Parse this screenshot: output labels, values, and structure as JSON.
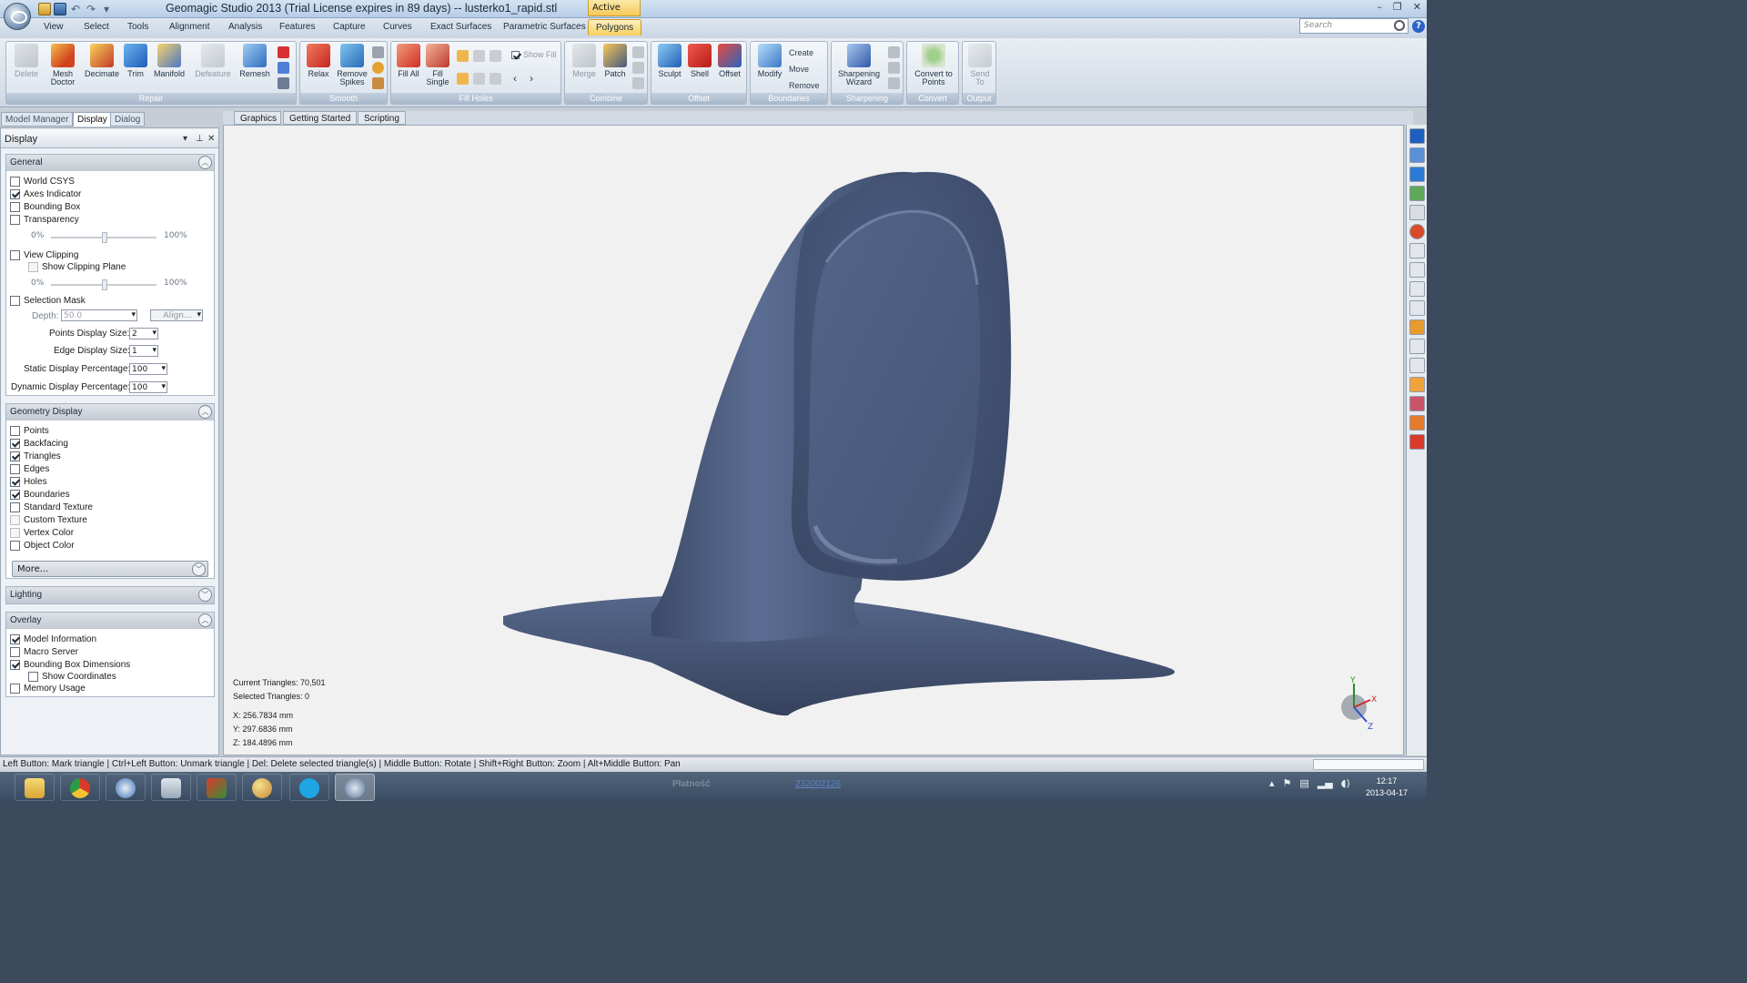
{
  "window": {
    "title": "Geomagic Studio 2013 (Trial License expires in 89 days) -- lusterko1_rapid.stl",
    "active_badge": "Active"
  },
  "menu": {
    "tabs": [
      "View",
      "Select",
      "Tools",
      "Alignment",
      "Analysis",
      "Features",
      "Capture",
      "Curves",
      "Exact Surfaces",
      "Parametric Surfaces",
      "Polygons"
    ],
    "selected": "Polygons"
  },
  "search": {
    "placeholder": "Search"
  },
  "ribbon": {
    "groups": {
      "repair": {
        "label": "Repair",
        "buttons": [
          "Delete",
          "Mesh Doctor",
          "Decimate",
          "Trim",
          "Manifold",
          "Defeature",
          "Remesh"
        ]
      },
      "smooth": {
        "label": "Smooth",
        "buttons": [
          "Relax",
          "Remove Spikes"
        ]
      },
      "fill_holes": {
        "label": "Fill Holes",
        "buttons": [
          "Fill All",
          "Fill Single"
        ],
        "show_fill": "Show Fill"
      },
      "combine": {
        "label": "Combine",
        "buttons": [
          "Merge",
          "Patch"
        ]
      },
      "offset": {
        "label": "Offset",
        "buttons": [
          "Sculpt",
          "Shell",
          "Offset"
        ]
      },
      "boundaries": {
        "label": "Boundaries",
        "buttons": [
          "Modify"
        ],
        "small": [
          "Create",
          "Move",
          "Remove"
        ]
      },
      "sharpening": {
        "label": "Sharpening",
        "buttons": [
          "Sharpening Wizard"
        ]
      },
      "convert": {
        "label": "Convert",
        "buttons": [
          "Convert to Points"
        ]
      },
      "output": {
        "label": "Output",
        "buttons": [
          "Send To"
        ]
      }
    }
  },
  "panel": {
    "tabs": [
      "Model Manager",
      "Display",
      "Dialog"
    ],
    "selected_tab": "Display",
    "title": "Display",
    "general": {
      "title": "General",
      "items": [
        {
          "label": "World CSYS",
          "checked": false
        },
        {
          "label": "Axes Indicator",
          "checked": true
        },
        {
          "label": "Bounding Box",
          "checked": false
        },
        {
          "label": "Transparency",
          "checked": false
        }
      ],
      "slider_min": "0%",
      "slider_max": "100%",
      "view_clipping": "View Clipping",
      "show_clipping_plane": "Show Clipping Plane",
      "selection_mask": "Selection Mask",
      "depth_label": "Depth:",
      "depth_value": "50.0",
      "align_button": "Align...",
      "points_size_label": "Points Display Size:",
      "points_size_value": "2",
      "edge_size_label": "Edge Display Size:",
      "edge_size_value": "1",
      "static_pct_label": "Static Display Percentage:",
      "static_pct_value": "100",
      "dynamic_pct_label": "Dynamic Display Percentage:",
      "dynamic_pct_value": "100"
    },
    "geometry": {
      "title": "Geometry Display",
      "items": [
        {
          "label": "Points",
          "checked": false
        },
        {
          "label": "Backfacing",
          "checked": true
        },
        {
          "label": "Triangles",
          "checked": true
        },
        {
          "label": "Edges",
          "checked": false
        },
        {
          "label": "Holes",
          "checked": true
        },
        {
          "label": "Boundaries",
          "checked": true
        },
        {
          "label": "Standard Texture",
          "checked": false
        },
        {
          "label": "Custom Texture",
          "checked": false
        },
        {
          "label": "Vertex Color",
          "checked": false
        },
        {
          "label": "Object Color",
          "checked": false
        }
      ],
      "more_button": "More..."
    },
    "lighting": {
      "title": "Lighting"
    },
    "overlay": {
      "title": "Overlay",
      "items": [
        {
          "label": "Model Information",
          "checked": true
        },
        {
          "label": "Macro Server",
          "checked": false
        },
        {
          "label": "Bounding Box Dimensions",
          "checked": true
        },
        {
          "label": "Show Coordinates",
          "checked": false
        },
        {
          "label": "Memory Usage",
          "checked": false
        }
      ]
    }
  },
  "viewport": {
    "tabs": [
      "Graphics",
      "Getting Started",
      "Scripting"
    ],
    "selected_tab": "Graphics",
    "info": {
      "current_triangles": "Current Triangles: 70,501",
      "selected_triangles": "Selected Triangles: 0",
      "x": "X:  256.7834 mm",
      "y": "Y:  297.6836 mm",
      "z": "Z:  184.4896 mm"
    },
    "axes": {
      "x": "X",
      "y": "Y",
      "z": "Z"
    },
    "model_color": "#4a5a7c"
  },
  "status": {
    "text": "Left Button: Mark triangle | Ctrl+Left Button: Unmark triangle | Del: Delete selected triangle(s) | Middle Button: Rotate | Shift+Right Button: Zoom | Alt+Middle Button: Pan"
  },
  "taskbar": {
    "text1": "Płatność",
    "text2": "232002126",
    "time": "12:17",
    "date": "2013-04-17"
  }
}
